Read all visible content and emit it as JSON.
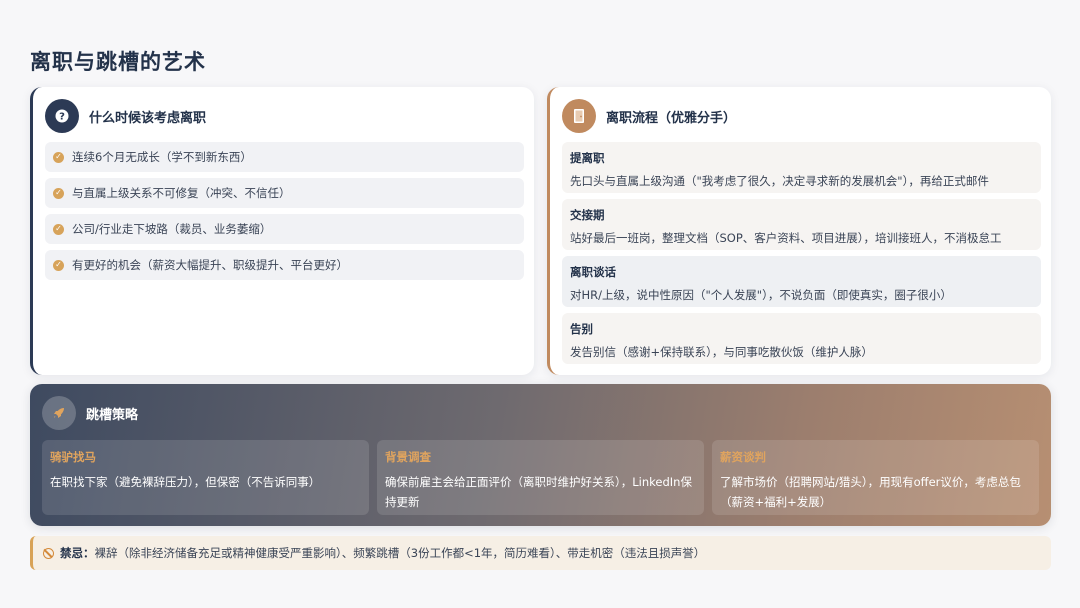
{
  "title": "离职与跳槽的艺术",
  "when": {
    "heading": "什么时候该考虑离职",
    "icon": "question-icon",
    "items": [
      "连续6个月无成长（学不到新东西）",
      "与直属上级关系不可修复（冲突、不信任）",
      "公司/行业走下坡路（裁员、业务萎缩）",
      "有更好的机会（薪资大幅提升、职级提升、平台更好）"
    ]
  },
  "process": {
    "heading": "离职流程（优雅分手）",
    "icon": "door-icon",
    "steps": [
      {
        "title": "提离职",
        "desc": "先口头与直属上级沟通（\"我考虑了很久，决定寻求新的发展机会\"），再给正式邮件"
      },
      {
        "title": "交接期",
        "desc": "站好最后一班岗，整理文档（SOP、客户资料、项目进展），培训接班人，不消极怠工"
      },
      {
        "title": "离职谈话",
        "desc": "对HR/上级，说中性原因（\"个人发展\"），不说负面（即使真实，圈子很小）"
      },
      {
        "title": "告别",
        "desc": "发告别信（感谢+保持联系），与同事吃散伙饭（维护人脉）"
      }
    ]
  },
  "strategy": {
    "heading": "跳槽策略",
    "icon": "rocket-icon",
    "boxes": [
      {
        "title": "骑驴找马",
        "desc": "在职找下家（避免裸辞压力），但保密（不告诉同事）"
      },
      {
        "title": "背景调查",
        "desc": "确保前雇主会给正面评价（离职时维护好关系），LinkedIn保持更新"
      },
      {
        "title": "薪资谈判",
        "desc": "了解市场价（招聘网站/猎头），用现有offer议价，考虑总包（薪资+福利+发展）"
      }
    ]
  },
  "warning": {
    "label": "禁忌：",
    "text": "裸辞（除非经济储备充足或精神健康受严重影响）、频繁跳槽（3份工作都<1年，简历难看）、带走机密（违法且损声誉）",
    "icon": "ban-icon"
  }
}
